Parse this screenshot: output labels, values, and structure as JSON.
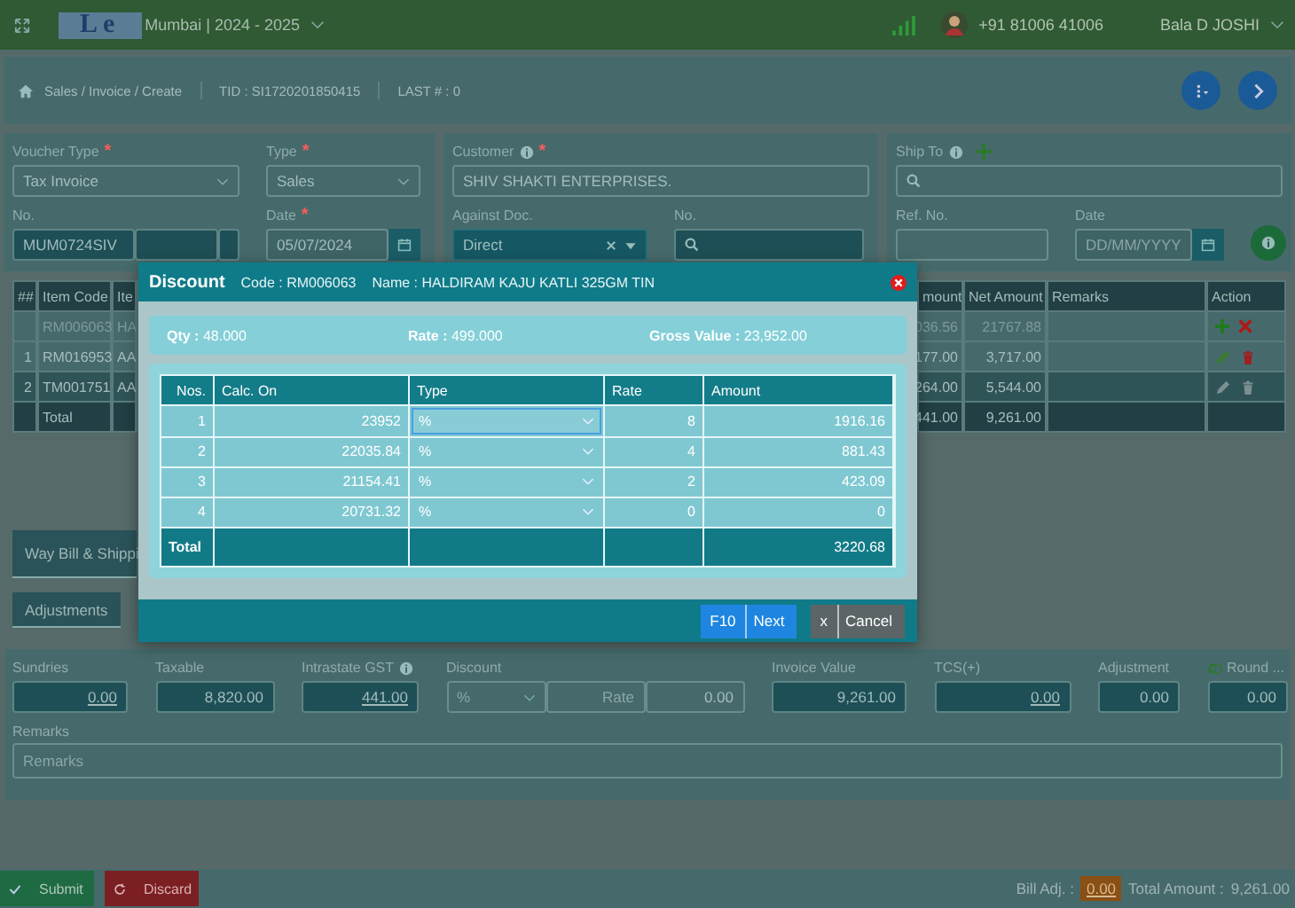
{
  "top_bar": {
    "logo": "Le",
    "branch": "Mumbai | 2024 - 2025",
    "phone": "+91 81006 41006",
    "user": "Bala D JOSHI"
  },
  "breadcrumb": {
    "path": "Sales / Invoice / Create",
    "tid": "TID : SI1720201850415",
    "last": "LAST # : 0"
  },
  "form_cards": [
    {
      "rows": [
        [
          {
            "label": "Voucher Type",
            "mark": "*",
            "kind": "select",
            "value": "Tax Invoice"
          },
          {
            "label": "Type",
            "mark": "*",
            "kind": "select",
            "value": "Sales"
          }
        ],
        [
          {
            "label": "No.",
            "kind": "segmented",
            "value": "MUM0724SIV"
          },
          {
            "label": "Date",
            "mark": "*",
            "kind": "date",
            "value": "05/07/2024"
          }
        ]
      ]
    },
    {
      "rows": [
        [
          {
            "label": "Customer",
            "info": true,
            "mark": "*",
            "kind": "text",
            "value": "SHIV SHAKTI ENTERPRISES."
          }
        ],
        [
          {
            "label": "Against Doc.",
            "kind": "clear-select",
            "value": "Direct"
          },
          {
            "label": "No.",
            "kind": "search"
          }
        ]
      ]
    },
    {
      "rows": [
        [
          {
            "label": "Ship To",
            "info": true,
            "add": true,
            "kind": "search"
          }
        ],
        [
          {
            "label": "Ref. No.",
            "kind": "text"
          },
          {
            "label": "Date",
            "kind": "date",
            "placeholder": "DD/MM/YYYY"
          }
        ]
      ],
      "info_button": true
    }
  ],
  "items_table": {
    "columns_left": [
      "##",
      "Item Code",
      "Ite"
    ],
    "columns_right": [
      "mount",
      "Net Amount",
      "Remarks",
      "Action"
    ],
    "rows": [
      {
        "kind": "entry",
        "selected": false,
        "no": "",
        "code": "RM006063",
        "item": "HA",
        "amount": "036.56",
        "net": "21767.88"
      },
      {
        "kind": "item",
        "selected": false,
        "actions_enabled": true,
        "no": "1",
        "code": "RM016953",
        "item": "AA",
        "amount": "177.00",
        "net": "3,717.00"
      },
      {
        "kind": "item",
        "selected": true,
        "actions_enabled": false,
        "no": "2",
        "code": "TM001751",
        "item": "AA",
        "amount": "264.00",
        "net": "5,544.00"
      }
    ],
    "total": {
      "label": "Total",
      "amount": "441.00",
      "net": "9,261.00"
    }
  },
  "sections": [
    "Way Bill & Shippi",
    "Adjustments"
  ],
  "totals": [
    {
      "label": "Sundries",
      "kind": "value",
      "underline": true,
      "value": "0.00"
    },
    {
      "label": "Taxable",
      "kind": "value",
      "underline": false,
      "value": "8,820.00"
    },
    {
      "label": "Intrastate GST",
      "info": true,
      "kind": "value",
      "underline": true,
      "value": "441.00"
    },
    {
      "label": "Discount",
      "kind": "discount",
      "type": "%",
      "placeholder": "Rate",
      "value": "0.00"
    },
    {
      "label": "Invoice Value",
      "kind": "value",
      "underline": false,
      "value": "9,261.00"
    },
    {
      "label": "TCS(+)",
      "kind": "input",
      "underline": true,
      "value": "0.00"
    },
    {
      "label": "Adjustment",
      "kind": "value",
      "underline": false,
      "value": "0.00"
    },
    {
      "label": "Round ...",
      "toggle": true,
      "kind": "value",
      "underline": false,
      "value": "0.00"
    }
  ],
  "remarks": {
    "label": "Remarks",
    "placeholder": "Remarks"
  },
  "footer": {
    "submit": "Submit",
    "discard": "Discard",
    "bill_adj_label": "Bill Adj. :",
    "bill_adj": "0.00",
    "total_label": "Total Amount :",
    "total": "9,261.00"
  },
  "modal": {
    "title": "Discount",
    "code": "Code : RM006063",
    "name": "Name : HALDIRAM KAJU KATLI 325GM TIN",
    "summary": [
      "**Qty :** 48.000",
      "**Rate :** 499.000",
      "**Gross Value :** 23,952.00"
    ],
    "columns": [
      "Nos.",
      "Calc. On",
      "Type",
      "Rate",
      "Amount"
    ],
    "rows": [
      {
        "no": "1",
        "calc": "23952",
        "type": "%",
        "focused": true,
        "rate": "8",
        "amount": "1916.16"
      },
      {
        "no": "2",
        "calc": "22035.84",
        "type": "%",
        "focused": false,
        "rate": "4",
        "amount": "881.43"
      },
      {
        "no": "3",
        "calc": "21154.41",
        "type": "%",
        "focused": false,
        "rate": "2",
        "amount": "423.09"
      },
      {
        "no": "4",
        "calc": "20731.32",
        "type": "%",
        "focused": false,
        "rate": "0",
        "amount": "0"
      }
    ],
    "total": {
      "label": "Total",
      "amount": "3220.68"
    },
    "buttons": [
      {
        "kind": "primary",
        "key": "F10",
        "label": "Next"
      },
      {
        "kind": "secondary",
        "key": "x",
        "label": "Cancel"
      }
    ]
  }
}
